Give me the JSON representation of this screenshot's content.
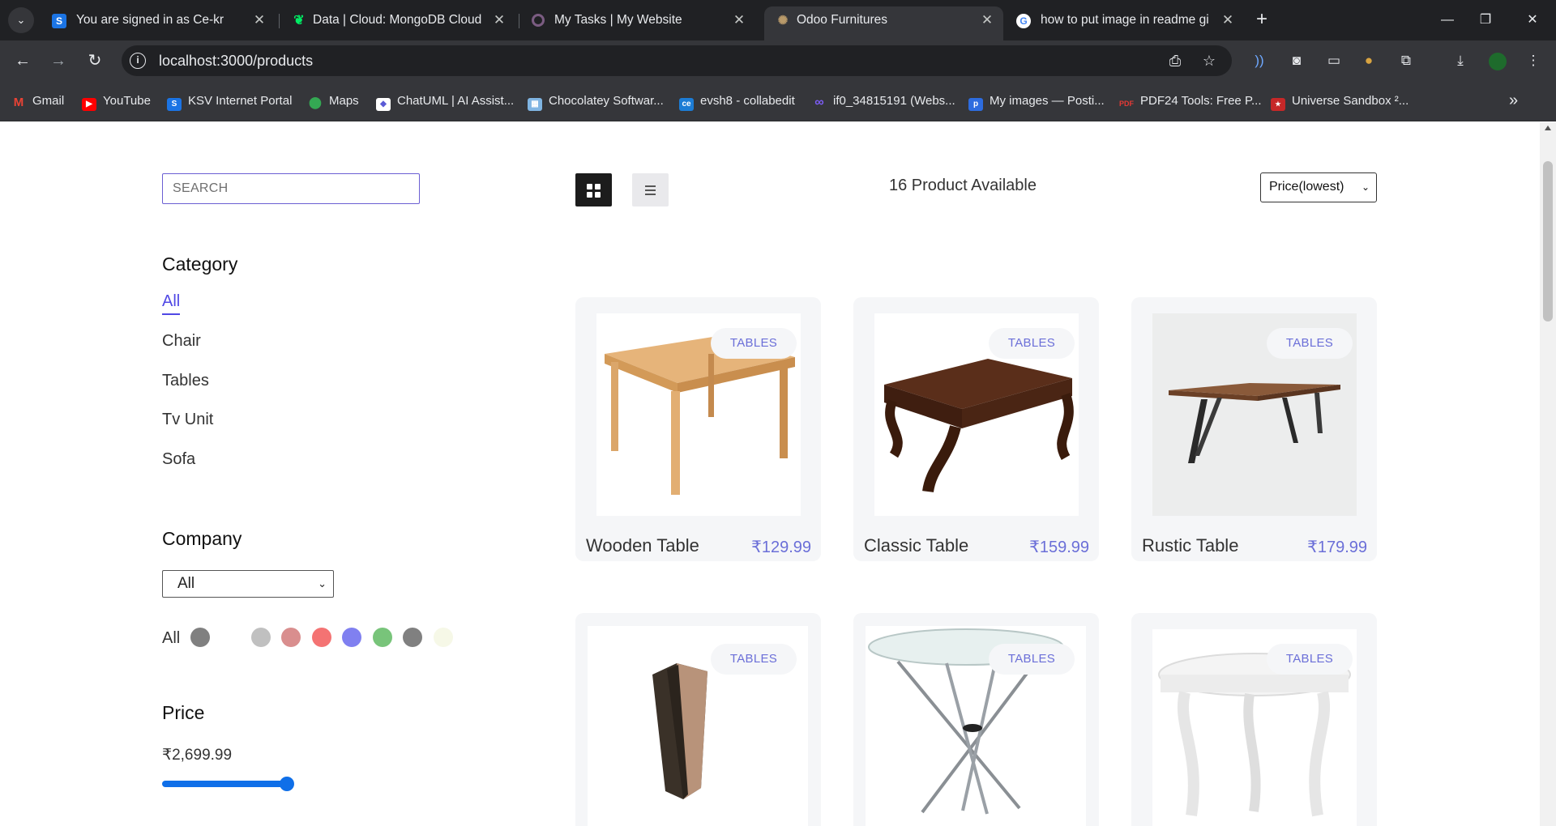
{
  "browser": {
    "tabs": [
      {
        "title": "You are signed in as Ce-kr",
        "favicon": "S",
        "favicon_color": "#1b74e4"
      },
      {
        "title": "Data | Cloud: MongoDB Cloud",
        "favicon": "leaf",
        "favicon_color": "#00ed64"
      },
      {
        "title": "My Tasks | My Website",
        "favicon": "circle",
        "favicon_color": "#7b5c82"
      },
      {
        "title": "Odoo Furnitures",
        "favicon": "sun",
        "favicon_color": "#b99a6a"
      },
      {
        "title": "how to put image in readme gi",
        "favicon": "G",
        "favicon_color": "#4285f4"
      }
    ],
    "active_tab_index": 3,
    "new_tab_symbol": "+",
    "url": "localhost:3000/products",
    "bookmarks": [
      {
        "label": "Gmail",
        "icon": "gmail-icon",
        "color": "#ea4335"
      },
      {
        "label": "YouTube",
        "icon": "youtube-icon",
        "color": "#ff0000"
      },
      {
        "label": "KSV Internet Portal",
        "icon": "ksv-icon",
        "color": "#1b74e4"
      },
      {
        "label": "Maps",
        "icon": "maps-icon",
        "color": "#34a853"
      },
      {
        "label": "ChatUML | AI Assist...",
        "icon": "chatuml-icon",
        "color": "#5b5bd6"
      },
      {
        "label": "Chocolatey Softwar...",
        "icon": "chocolatey-icon",
        "color": "#80b5e3"
      },
      {
        "label": "evsh8 - collabedit",
        "icon": "collabedit-icon",
        "color": "#1c7cd5"
      },
      {
        "label": "if0_34815191 (Webs...",
        "icon": "infinity-icon",
        "color": "#7c5cf5"
      },
      {
        "label": "My images — Posti...",
        "icon": "postimg-icon",
        "color": "#2d6cdf"
      },
      {
        "label": "PDF24 Tools: Free P...",
        "icon": "pdf24-icon",
        "color": "#e53935"
      },
      {
        "label": "Universe Sandbox ²...",
        "icon": "universe-icon",
        "color": "#c62828"
      }
    ]
  },
  "filters": {
    "search_placeholder": "SEARCH",
    "category_title": "Category",
    "categories": [
      "All",
      "Chair",
      "Tables",
      "Tv Unit",
      "Sofa"
    ],
    "active_category": "All",
    "company_title": "Company",
    "company_selected": "All",
    "colors_all_label": "All",
    "colors": [
      "#808080",
      "#c0c0c0",
      "#d98e8e",
      "#f47373",
      "#8080f0",
      "#78c47a",
      "#808080",
      "#f6f8e7"
    ],
    "price_title": "Price",
    "price_value": "₹2,699.99",
    "price_fraction": 1.0
  },
  "toolbar": {
    "product_count": "16 Product Available",
    "sort_selected": "Price(lowest)"
  },
  "products": [
    {
      "name": "Wooden Table",
      "price": "₹129.99",
      "category": "TABLES"
    },
    {
      "name": "Classic Table",
      "price": "₹159.99",
      "category": "TABLES"
    },
    {
      "name": "Rustic Table",
      "price": "₹179.99",
      "category": "TABLES"
    },
    {
      "name": "",
      "price": "",
      "category": "TABLES"
    },
    {
      "name": "",
      "price": "",
      "category": "TABLES"
    },
    {
      "name": "",
      "price": "",
      "category": "TABLES"
    }
  ],
  "accent_color": "#5048e5",
  "price_color": "#6b6fd8"
}
